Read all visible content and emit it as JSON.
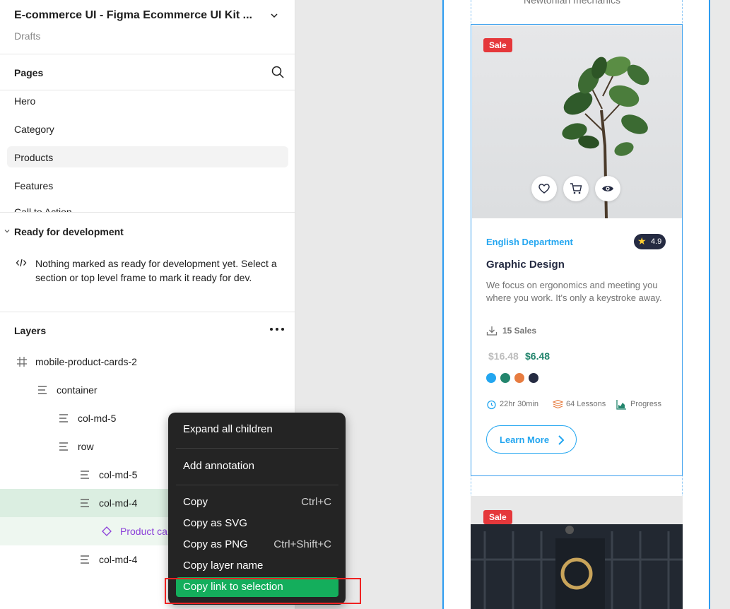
{
  "file": {
    "title": "E-commerce UI - Figma Ecommerce UI Kit ...",
    "location": "Drafts"
  },
  "pages": {
    "title": "Pages",
    "items": [
      "Hero",
      "Category",
      "Products",
      "Features",
      "Call to Action"
    ],
    "active": "Products"
  },
  "dev": {
    "title": "Ready for development",
    "message": "Nothing marked as ready for development yet. Select a section or top level frame to mark it ready for dev."
  },
  "layers": {
    "title": "Layers",
    "items": [
      {
        "name": "mobile-product-cards-2",
        "type": "frame"
      },
      {
        "name": "container",
        "type": "autolayout"
      },
      {
        "name": "col-md-5",
        "type": "autolayout"
      },
      {
        "name": "row",
        "type": "autolayout"
      },
      {
        "name": "col-md-5",
        "type": "autolayout"
      },
      {
        "name": "col-md-4",
        "type": "autolayout"
      },
      {
        "name": "Product ca",
        "type": "instance"
      },
      {
        "name": "col-md-4",
        "type": "autolayout"
      }
    ]
  },
  "context_menu": {
    "items": [
      {
        "label": "Expand all children",
        "shortcut": ""
      },
      {
        "label": "Add annotation",
        "shortcut": ""
      },
      {
        "label": "Copy",
        "shortcut": "Ctrl+C"
      },
      {
        "label": "Copy as SVG",
        "shortcut": ""
      },
      {
        "label": "Copy as PNG",
        "shortcut": "Ctrl+Shift+C"
      },
      {
        "label": "Copy layer name",
        "shortcut": ""
      },
      {
        "label": "Copy link to selection",
        "shortcut": ""
      }
    ],
    "highlighted": "Copy link to selection"
  },
  "canvas": {
    "top_text": "Newtonian mechanics",
    "card": {
      "badge": "Sale",
      "department": "English Department",
      "rating": "4.9",
      "title": "Graphic Design",
      "description": "We focus on ergonomics and meeting you where you work. It's only a keystroke away.",
      "sales": "15 Sales",
      "old_price": "$16.48",
      "new_price": "$6.48",
      "colors": [
        "#23a6f0",
        "#23856d",
        "#e77c40",
        "#252b42"
      ],
      "duration": "22hr 30min",
      "lessons": "64 Lessons",
      "progress": "Progress",
      "cta": "Learn More"
    },
    "card2": {
      "badge": "Sale"
    }
  }
}
